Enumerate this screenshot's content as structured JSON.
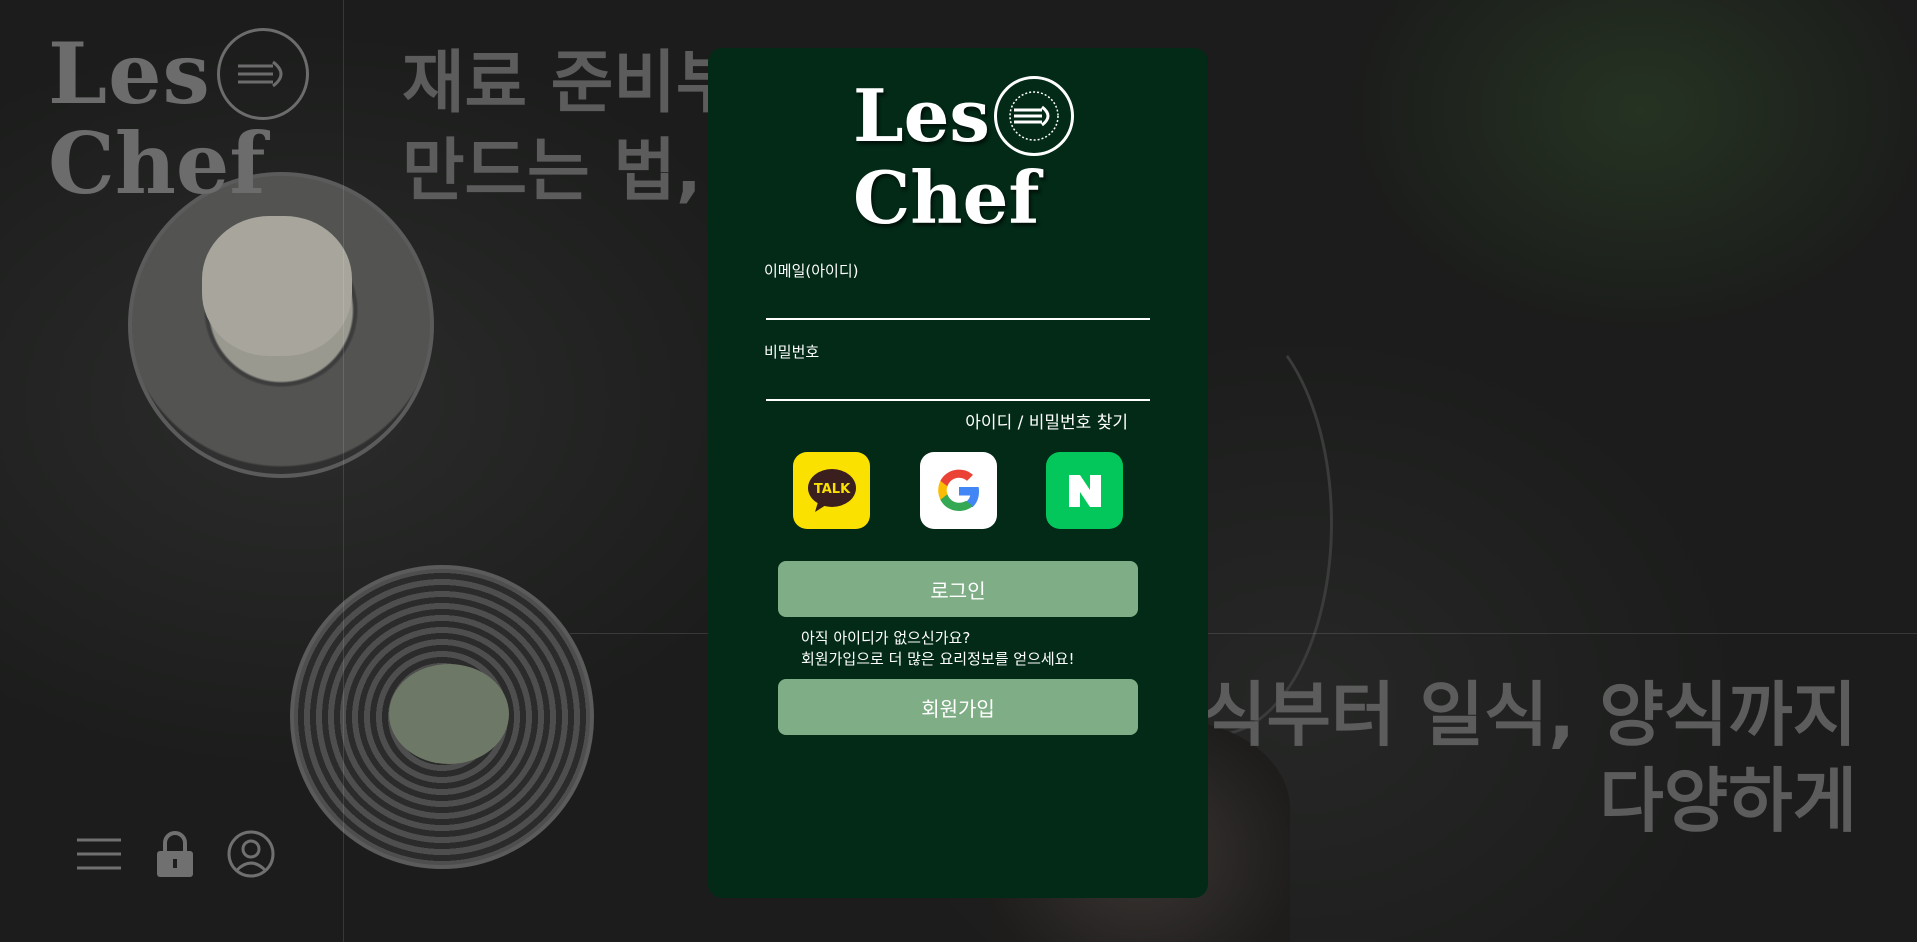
{
  "brand": {
    "line1": "Les",
    "line2": "Chef"
  },
  "background": {
    "headline_top": [
      "재료 준비부",
      "만드는 법,"
    ],
    "headline_bottom": [
      "식부터 일식, 양식까지",
      "다양하게"
    ]
  },
  "bottom_nav": {
    "icons": [
      "menu-icon",
      "lock-icon",
      "user-icon"
    ]
  },
  "login": {
    "email_label": "이메일(아이디)",
    "email_value": "",
    "password_label": "비밀번호",
    "password_value": "",
    "find_link": "아이디 / 비밀번호 찾기",
    "social": [
      {
        "name": "kakao",
        "label": "TALK",
        "color": "#fae100"
      },
      {
        "name": "google",
        "label": "G",
        "color": "#ffffff"
      },
      {
        "name": "naver",
        "label": "N",
        "color": "#03c75a"
      }
    ],
    "login_button": "로그인",
    "signup_msg_line1": "아직 아이디가 없으신가요?",
    "signup_msg_line2": "회원가입으로 더 많은 요리정보를 얻으세요!",
    "signup_button": "회원가입"
  },
  "colors": {
    "modal_bg": "#022a17",
    "button_bg": "#7fae86",
    "kakao": "#fae100",
    "naver": "#03c75a"
  }
}
